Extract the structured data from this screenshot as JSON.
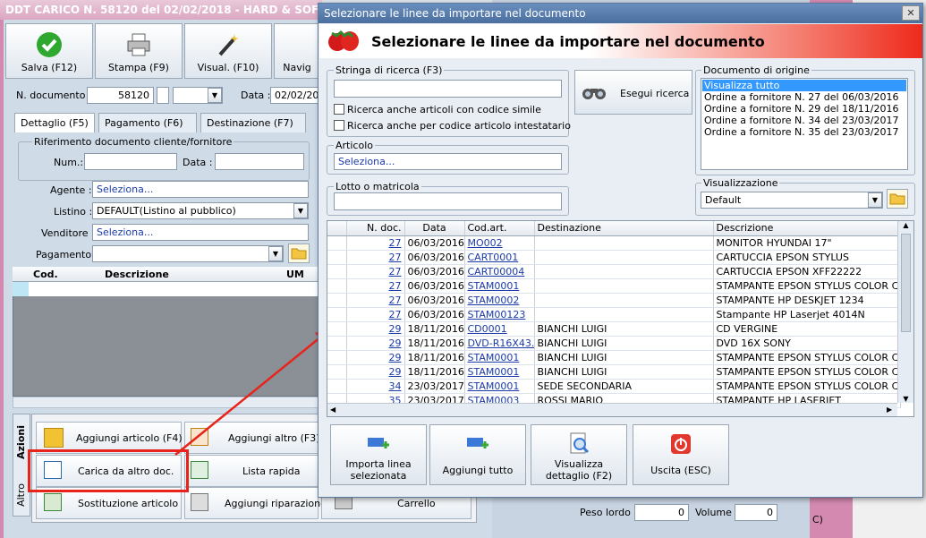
{
  "main": {
    "title": "DDT CARICO N. 58120 del 02/02/2018 - HARD & SOFT S",
    "toolbar": {
      "save": "Salva (F12)",
      "print": "Stampa (F9)",
      "view": "Visual. (F10)",
      "nav": "Navig"
    },
    "doc_number_label": "N. documento :",
    "doc_number": "58120",
    "date_label": "Data :",
    "date": "02/02/201",
    "tabs": [
      "Dettaglio (F5)",
      "Pagamento (F6)",
      "Destinazione (F7)"
    ],
    "ref_group": "Riferimento documento cliente/fornitore",
    "num_label": "Num.:",
    "ref_date_label": "Data :",
    "agent_label": "Agente :",
    "agent_value": "Seleziona...",
    "list_label": "Listino :",
    "list_value": "DEFAULT(Listino al pubblico)",
    "seller_label": "Venditore :",
    "seller_value": "Seleziona...",
    "payment_label": "Pagamento :",
    "lines_cols": [
      "Cod.",
      "Descrizione",
      "UM"
    ],
    "side_tabs": [
      "Azioni",
      "Altro"
    ],
    "actions": {
      "add_article": "Aggiungi articolo (F4)",
      "add_other": "Aggiungi altro (F3)",
      "load_other": "Carica da altro doc.",
      "quick_list": "Lista rapida",
      "replace_article": "Sostituzione articolo",
      "add_repair": "Aggiungi riparazione",
      "cart": "Carrello"
    },
    "gross_weight_label": "Peso lordo :",
    "gross_weight": "0",
    "volume_label": "Volume :",
    "volume": "0",
    "right_frag": "C)"
  },
  "dialog": {
    "title": "Selezionare le linee da importare nel documento",
    "header": "Selezionare le linee da importare nel documento",
    "search_group": "Stringa di ricerca (F3)",
    "search_value": "",
    "chk_similar": "Ricerca anche articoli con codice simile",
    "chk_holder": "Ricerca anche per codice articolo intestatario",
    "search_button": "Esegui ricerca",
    "article_group": "Articolo",
    "article_value": "Seleziona...",
    "lot_group": "Lotto o matricola",
    "origin_group": "Documento di origine",
    "origin_items": [
      "Visualizza tutto",
      "Ordine a fornitore N. 27 del 06/03/2016",
      "Ordine a fornitore N. 29 del 18/11/2016",
      "Ordine a fornitore N. 34 del 23/03/2017",
      "Ordine a fornitore N. 35 del 23/03/2017"
    ],
    "view_group": "Visualizzazione",
    "view_value": "Default",
    "columns": [
      "N. doc.",
      "Data",
      "Cod.art.",
      "Destinazione",
      "Descrizione"
    ],
    "rows": [
      [
        "27",
        "06/03/2016",
        "MO002",
        "",
        "MONITOR HYUNDAI 17\""
      ],
      [
        "27",
        "06/03/2016",
        "CART0001",
        "",
        "CARTUCCIA EPSON STYLUS"
      ],
      [
        "27",
        "06/03/2016",
        "CART00004",
        "",
        "CARTUCCIA EPSON XFF22222"
      ],
      [
        "27",
        "06/03/2016",
        "STAM0001",
        "",
        "STAMPANTE EPSON STYLUS COLOR C..."
      ],
      [
        "27",
        "06/03/2016",
        "STAM0002",
        "",
        "STAMPANTE HP DESKJET 1234"
      ],
      [
        "27",
        "06/03/2016",
        "STAM00123",
        "",
        "Stampante HP Laserjet 4014N"
      ],
      [
        "29",
        "18/11/2016",
        "CD0001",
        "BIANCHI LUIGI",
        "CD VERGINE"
      ],
      [
        "29",
        "18/11/2016",
        "DVD-R16X43...",
        "BIANCHI LUIGI",
        "DVD 16X SONY"
      ],
      [
        "29",
        "18/11/2016",
        "STAM0001",
        "BIANCHI LUIGI",
        "STAMPANTE EPSON STYLUS COLOR C..."
      ],
      [
        "29",
        "18/11/2016",
        "STAM0001",
        "BIANCHI LUIGI",
        "STAMPANTE EPSON STYLUS COLOR C..."
      ],
      [
        "34",
        "23/03/2017",
        "STAM0001",
        "SEDE SECONDARIA",
        "STAMPANTE EPSON STYLUS COLOR C..."
      ],
      [
        "35",
        "23/03/2017",
        "STAM0003",
        "ROSSI MARIO",
        "STAMPANTE HP LASERJET"
      ]
    ],
    "buttons": {
      "import_selected": "Importa linea selezionata",
      "add_all": "Aggiungi tutto",
      "view_detail": "Visualizza dettaglio (F2)",
      "exit": "Uscita (ESC)"
    }
  },
  "colors": {
    "highlight_red": "#e8231a",
    "selection_blue": "#3399ff",
    "link_blue": "#1b3aa8"
  }
}
